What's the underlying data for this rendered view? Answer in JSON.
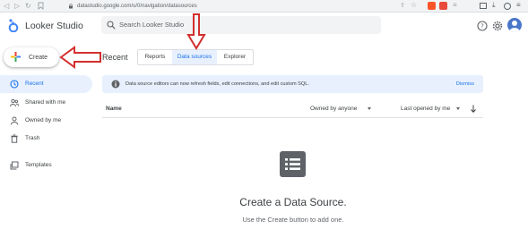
{
  "browser": {
    "url": "datastudio.google.com/u/0/navigation/datasources",
    "icons": [
      "back-icon",
      "forward-icon",
      "reload-icon",
      "bookmark-icon",
      "share-icon",
      "star-icon",
      "brave-shield-icon",
      "brave-rewards-icon",
      "menu-icon",
      "sidebar-icon",
      "download-icon",
      "profile-icon"
    ]
  },
  "header": {
    "app_title": "Looker Studio",
    "search_placeholder": "Search Looker Studio",
    "icons": [
      "help-icon",
      "settings-icon",
      "avatar"
    ]
  },
  "sidebar": {
    "create_label": "Create",
    "items": [
      {
        "label": "Recent",
        "icon": "clock-icon",
        "active": true
      },
      {
        "label": "Shared with me",
        "icon": "people-icon",
        "active": false
      },
      {
        "label": "Owned by me",
        "icon": "person-icon",
        "active": false
      },
      {
        "label": "Trash",
        "icon": "trash-icon",
        "active": false
      },
      {
        "label": "Templates",
        "icon": "templates-icon",
        "active": false
      }
    ]
  },
  "main": {
    "section_title": "Recent",
    "tabs": [
      {
        "label": "Reports",
        "active": false
      },
      {
        "label": "Data sources",
        "active": true
      },
      {
        "label": "Explorer",
        "active": false
      }
    ],
    "banner": {
      "text": "Data source editors can now refresh fields, edit connections, and edit custom SQL.",
      "dismiss_label": "Dismiss"
    },
    "table": {
      "col_name": "Name",
      "col_owner": "Owned by anyone",
      "col_sort": "Last opened by me"
    },
    "empty_state": {
      "title": "Create a Data Source.",
      "subtitle": "Use the Create button to add one."
    }
  },
  "colors": {
    "accent": "#1a73e8",
    "active_bg": "#e8f0fe",
    "annotation": "#d32f2f"
  }
}
